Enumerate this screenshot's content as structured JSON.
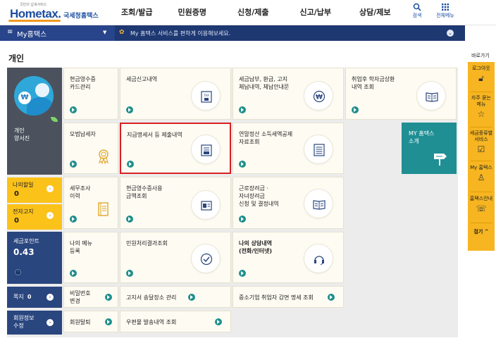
{
  "header": {
    "logo_tagline": "국민의 납세서비스",
    "logo_word_home": "Home",
    "logo_word_tax": "tax.",
    "logo_korean": "국세청홈택스",
    "nav": [
      "조회/발급",
      "민원증명",
      "신청/제출",
      "신고/납부",
      "상담/제보"
    ],
    "search_label": "검색",
    "menu_label": "전체메뉴",
    "search_icon": "search-icon",
    "menu_icon": "grid-menu-icon"
  },
  "mybar": {
    "title": "My홈택스",
    "notice": "My 홈택스 서비스를 편하게 이용해보세요."
  },
  "section_title": "개인",
  "left": {
    "profile_label_line1": "개인",
    "profile_label_line2": "양서진",
    "schedule_label": "나의할일",
    "schedule_count": "0",
    "notice_label": "전자고지",
    "notice_count": "0",
    "points_label": "세금포인트",
    "points_value": "0.43",
    "refund_label": "쪽지",
    "refund_count": "0",
    "member_line1": "회원정보",
    "member_line2": "수정"
  },
  "tiles": {
    "cash_receipt_1": "현금영수증",
    "cash_receipt_2": "카드관리",
    "tax_report": "세금신고내역",
    "tax_payment_1": "세금납부, 환급, 고지",
    "tax_payment_2": "체납내역, 체납안내문",
    "student_loan_1": "취업후 학자금상환",
    "student_loan_2": "내역 조회",
    "model_taxpayer": "모범납세자",
    "statement_submit": "지급명세서 등 제출내역",
    "year_end_1": "연말정산 소득세액공제",
    "year_end_2": "자료조회",
    "my_hometax_1": "MY 홈택스",
    "my_hometax_2": "소개",
    "audit_1": "세무조사",
    "audit_2": "이력",
    "cash_use_1": "현금영수증사용",
    "cash_use_2": "금액조회",
    "earned_credit_1": "근로장려금 ·",
    "earned_credit_2": "자녀장려금",
    "earned_credit_3": "신청 및 결정내역",
    "my_menu_1": "나의 메뉴",
    "my_menu_2": "등록",
    "civil_result": "민원처리결과조회",
    "consult_1": "나의 상담내역",
    "consult_2": "(전화/인터넷)",
    "password_1": "비밀번호",
    "password_2": "변경",
    "notice_delivery": "고지서 송달장소 관리",
    "sme_reduction": "중소기업 취업자 감면 명세 조회",
    "withdraw": "회원탈퇴",
    "mail_history": "우편물 발송내역 조회"
  },
  "quick": {
    "header": "바로가기",
    "logout": "로그아웃",
    "faq_1": "자주 묻는",
    "faq_2": "메뉴",
    "tax_cert_1": "세금종류별",
    "tax_cert_2": "서비스",
    "my_hometax": "My 홈택스",
    "guide": "홈택스안내",
    "fold": "접기"
  },
  "colors": {
    "brand_blue": "#1b4ea0",
    "bar_navy": "#28448a",
    "yellow": "#fbc21a",
    "teal": "#1f8f94",
    "highlight_red": "#d82024"
  }
}
